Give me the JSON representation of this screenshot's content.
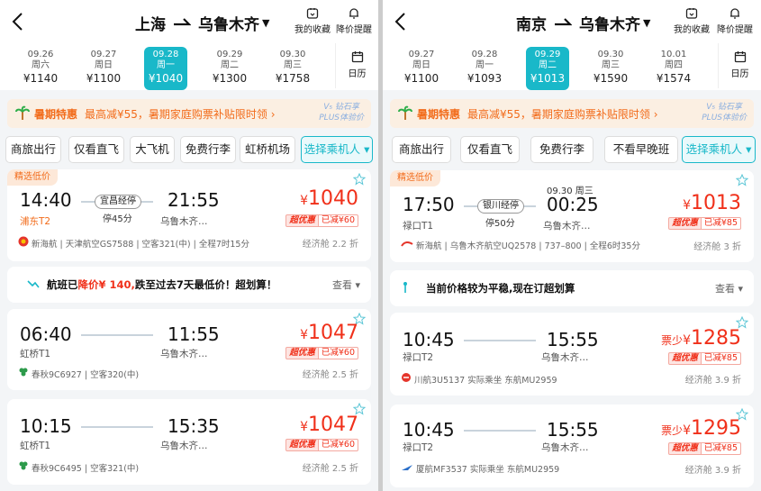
{
  "screens": [
    {
      "from": "上海",
      "to": "乌鲁木齐",
      "fav_label": "我的收藏",
      "alert_label": "降价提醒",
      "calendar_label": "日历",
      "dates": [
        {
          "d": "09.26",
          "w": "周六",
          "p": "¥1140"
        },
        {
          "d": "09.27",
          "w": "周日",
          "p": "¥1100"
        },
        {
          "d": "09.28",
          "w": "周一",
          "p": "¥1040"
        },
        {
          "d": "09.29",
          "w": "周二",
          "p": "¥1300"
        },
        {
          "d": "09.30",
          "w": "周三",
          "p": "¥1758"
        }
      ],
      "promo": {
        "title": "暑期特惠",
        "text": "最高减¥55，暑期家庭购票补贴限时领 ›",
        "plus1": "V₅ 钻石享",
        "plus2": "PLUS体验价"
      },
      "filters": [
        "商旅出行",
        "仅看直飞",
        "大飞机",
        "免费行李",
        "虹桥机场",
        "选择乘机人 ▾"
      ],
      "flights": [
        {
          "tag": "精选低价",
          "dep": "14:40",
          "dep_ap": "浦东T2",
          "stop_city": "宜昌经停",
          "stop_dur": "停45分",
          "arr": "21:55",
          "arr_ap": "乌鲁木齐…",
          "next_day": "",
          "price_prefix": "",
          "price": "1040",
          "b1": "超优惠",
          "b2": "已减¥60",
          "info": "新海航 | 天津航空GS7588 | 空客321(中) | 全程7时15分",
          "cabin": "经济舱 2.2 折"
        },
        {
          "tag": "",
          "dep": "06:40",
          "dep_ap": "虹桥T1",
          "stop_city": "",
          "stop_dur": "",
          "arr": "11:55",
          "arr_ap": "乌鲁木齐…",
          "next_day": "",
          "price_prefix": "",
          "price": "1047",
          "b1": "超优惠",
          "b2": "已减¥60",
          "info": "春秋9C6927 | 空客320(中)",
          "cabin": "经济舱 2.5 折"
        },
        {
          "tag": "",
          "dep": "10:15",
          "dep_ap": "虹桥T1",
          "stop_city": "",
          "stop_dur": "",
          "arr": "15:35",
          "arr_ap": "乌鲁木齐…",
          "next_day": "",
          "price_prefix": "",
          "price": "1047",
          "b1": "超优惠",
          "b2": "已减¥60",
          "info": "春秋9C6495 | 空客321(中)",
          "cabin": "经济舱 2.5 折"
        }
      ],
      "notice": {
        "pre": "航班已",
        "hl": "降价¥ 140,",
        "post": "跌至过去7天最低价！超划算！",
        "look": "查看 ▾"
      }
    },
    {
      "from": "南京",
      "to": "乌鲁木齐",
      "fav_label": "我的收藏",
      "alert_label": "降价提醒",
      "calendar_label": "日历",
      "dates": [
        {
          "d": "09.27",
          "w": "周日",
          "p": "¥1100"
        },
        {
          "d": "09.28",
          "w": "周一",
          "p": "¥1093"
        },
        {
          "d": "09.29",
          "w": "周二",
          "p": "¥1013"
        },
        {
          "d": "09.30",
          "w": "周三",
          "p": "¥1590"
        },
        {
          "d": "10.01",
          "w": "周四",
          "p": "¥1574"
        }
      ],
      "promo": {
        "title": "暑期特惠",
        "text": "最高减¥55，暑期家庭购票补贴限时领 ›",
        "plus1": "V₅ 钻石享",
        "plus2": "PLUS体验价"
      },
      "filters": [
        "商旅出行",
        "仅看直飞",
        "免费行李",
        "不看早晚班",
        "选择乘机人 ▾"
      ],
      "flights": [
        {
          "tag": "精选低价",
          "dep": "17:50",
          "dep_ap": "禄口T1",
          "stop_city": "银川经停",
          "stop_dur": "停50分",
          "arr": "00:25",
          "arr_ap": "乌鲁木齐…",
          "next_day": "09.30 周三",
          "price_prefix": "",
          "price": "1013",
          "b1": "超优惠",
          "b2": "已减¥85",
          "info": "新海航 | 乌鲁木齐航空UQ2578 | 737–800 | 全程6时35分",
          "cabin": "经济舱 3 折"
        },
        {
          "tag": "",
          "dep": "10:45",
          "dep_ap": "禄口T2",
          "stop_city": "",
          "stop_dur": "",
          "arr": "15:55",
          "arr_ap": "乌鲁木齐…",
          "next_day": "",
          "price_prefix": "票少",
          "price": "1285",
          "b1": "超优惠",
          "b2": "已减¥85",
          "info": "川航3U5137 实际乘坐 东航MU2959",
          "cabin": "经济舱 3.9 折"
        },
        {
          "tag": "",
          "dep": "10:45",
          "dep_ap": "禄口T2",
          "stop_city": "",
          "stop_dur": "",
          "arr": "15:55",
          "arr_ap": "乌鲁木齐…",
          "next_day": "",
          "price_prefix": "票少",
          "price": "1295",
          "b1": "超优惠",
          "b2": "已减¥85",
          "info": "厦航MF3537 实际乘坐 东航MU2959",
          "cabin": "经济舱 3.9 折"
        }
      ],
      "notice": {
        "pre": "当前价格较为平稳,现在订超划算",
        "hl": "",
        "post": "",
        "look": "查看 ▾"
      }
    }
  ],
  "colors": {
    "accent": "#19b8c9",
    "price_red": "#f0301a",
    "promo_orange": "#f26b1a"
  }
}
